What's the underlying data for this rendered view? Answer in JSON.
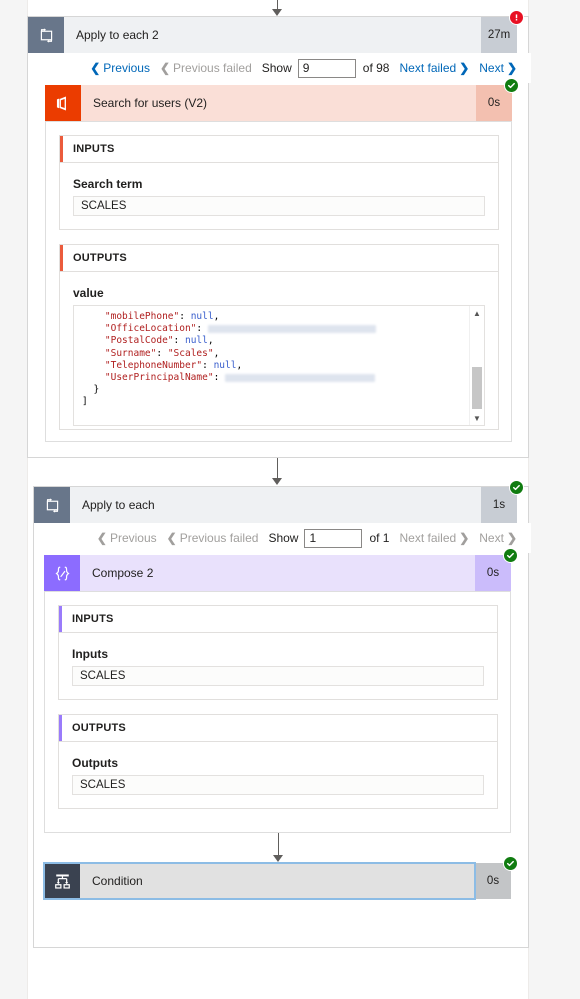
{
  "top_connector": {
    "name": "arrow-down"
  },
  "scope1": {
    "title": "Apply to each 2",
    "duration": "27m",
    "status": "error",
    "icon": "foreach-loop-icon",
    "pager": {
      "previous_label": "Previous",
      "previous_enabled": true,
      "previous_failed_label": "Previous failed",
      "previous_failed_enabled": false,
      "show_label": "Show",
      "show_value": "9",
      "of_label": "of 98",
      "next_failed_label": "Next failed",
      "next_failed_enabled": true,
      "next_label": "Next",
      "next_enabled": true
    },
    "action": {
      "title": "Search for users (V2)",
      "duration": "0s",
      "status": "success",
      "icon": "office365-users-icon",
      "inputs": {
        "section_label": "INPUTS",
        "field_label": "Search term",
        "field_value": "SCALES"
      },
      "outputs": {
        "section_label": "OUTPUTS",
        "field_label": "value",
        "json_lines": [
          {
            "indent": 4,
            "key": "\"mobilePhone\"",
            "value": "null",
            "value_type": "null",
            "trailing": ","
          },
          {
            "indent": 4,
            "key": "\"OfficeLocation\"",
            "value": "",
            "value_type": "redacted",
            "redact_width": 168,
            "trailing": ""
          },
          {
            "indent": 4,
            "key": "\"PostalCode\"",
            "value": "null",
            "value_type": "null",
            "trailing": ","
          },
          {
            "indent": 4,
            "key": "\"Surname\"",
            "value": "\"Scales\"",
            "value_type": "string",
            "trailing": ","
          },
          {
            "indent": 4,
            "key": "\"TelephoneNumber\"",
            "value": "null",
            "value_type": "null",
            "trailing": ","
          },
          {
            "indent": 4,
            "key": "\"UserPrincipalName\"",
            "value": "",
            "value_type": "redacted",
            "redact_width": 150,
            "trailing": ""
          },
          {
            "indent": 2,
            "key": "",
            "value": "}",
            "value_type": "punct",
            "trailing": ""
          },
          {
            "indent": 0,
            "key": "",
            "value": "]",
            "value_type": "punct",
            "trailing": ""
          }
        ]
      }
    }
  },
  "mid_connector": {
    "name": "arrow-down"
  },
  "scope2": {
    "title": "Apply to each",
    "duration": "1s",
    "status": "success",
    "icon": "foreach-loop-icon",
    "pager": {
      "previous_label": "Previous",
      "previous_enabled": false,
      "previous_failed_label": "Previous failed",
      "previous_failed_enabled": false,
      "show_label": "Show",
      "show_value": "1",
      "of_label": "of 1",
      "next_failed_label": "Next failed",
      "next_failed_enabled": false,
      "next_label": "Next",
      "next_enabled": false
    },
    "action": {
      "title": "Compose 2",
      "duration": "0s",
      "status": "success",
      "icon": "compose-braces-icon",
      "inputs": {
        "section_label": "INPUTS",
        "field_label": "Inputs",
        "field_value": "SCALES"
      },
      "outputs": {
        "section_label": "OUTPUTS",
        "field_label": "Outputs",
        "field_value": "SCALES"
      }
    },
    "inner_connector": {
      "name": "arrow-down"
    },
    "condition": {
      "title": "Condition",
      "duration": "0s",
      "status": "success",
      "icon": "condition-branch-icon",
      "selected": true
    }
  },
  "colors": {
    "scope_icon": "#68768a",
    "scope_header": "#eff1f3",
    "office_icon": "#eb3c00",
    "office_header": "#fadfd7",
    "compose_icon": "#8c6cff",
    "compose_header": "#e9e1fc",
    "condition_icon": "#3a4250",
    "condition_header": "#e1e1e1",
    "link": "#0067b8",
    "disabled": "#a19f9d",
    "success": "#107c10",
    "error": "#e81123",
    "selection": "#8cbce5"
  }
}
